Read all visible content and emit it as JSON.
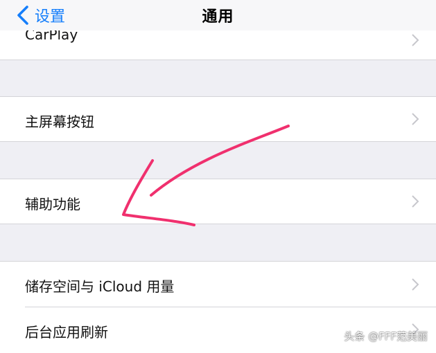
{
  "navbar": {
    "back_label": "设置",
    "title": "通用"
  },
  "rows": {
    "carplay": "CarPlay",
    "home_button": "主屏幕按钮",
    "accessibility": "辅助功能",
    "storage_icloud": "储存空间与 iCloud 用量",
    "background_refresh": "后台应用刷新"
  },
  "annotation": {
    "color": "#f0306e"
  },
  "watermark": "头条 @FFF范美丽",
  "colors": {
    "accent": "#157efb",
    "background": "#efeff4",
    "chevron": "#c7c7cc"
  }
}
